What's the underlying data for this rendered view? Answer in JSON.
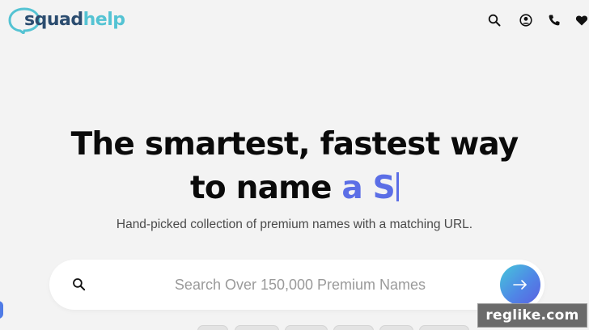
{
  "brand": {
    "logo_part1": "squad",
    "logo_part2": "help",
    "primary_color": "#2b4c6f",
    "secondary_color": "#54c3d3"
  },
  "nav": {
    "icons": [
      "search-icon",
      "account-icon",
      "phone-icon",
      "heart-icon"
    ]
  },
  "hero": {
    "title_line1": "The smartest, fastest way",
    "title_line2_prefix": "to name ",
    "title_line2_typed": "a S",
    "accent_color": "#5b6ee6",
    "subtitle": "Hand-picked collection of premium names with a matching URL."
  },
  "search": {
    "placeholder": "Search Over 150,000 Premium Names",
    "value": ""
  },
  "watermark": {
    "text": "reglike.com"
  }
}
